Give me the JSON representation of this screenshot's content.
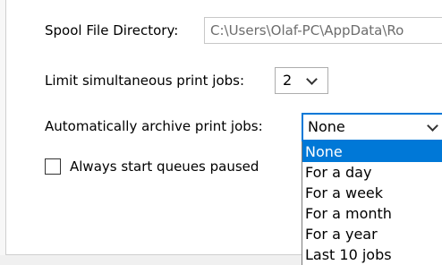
{
  "spool": {
    "label": "Spool File Directory:",
    "value": "C:\\Users\\Olaf-PC\\AppData\\Ro"
  },
  "limit": {
    "label": "Limit simultaneous print jobs:",
    "value": "2"
  },
  "archive": {
    "label": "Automatically archive print jobs:",
    "value": "None",
    "options": [
      "None",
      "For a day",
      "For a week",
      "For a month",
      "For a year",
      "Last 10 jobs"
    ]
  },
  "paused": {
    "label": "Always start queues paused",
    "checked": false
  },
  "colors": {
    "selection": "#0078d7",
    "field_text": "#6d6d6d"
  }
}
